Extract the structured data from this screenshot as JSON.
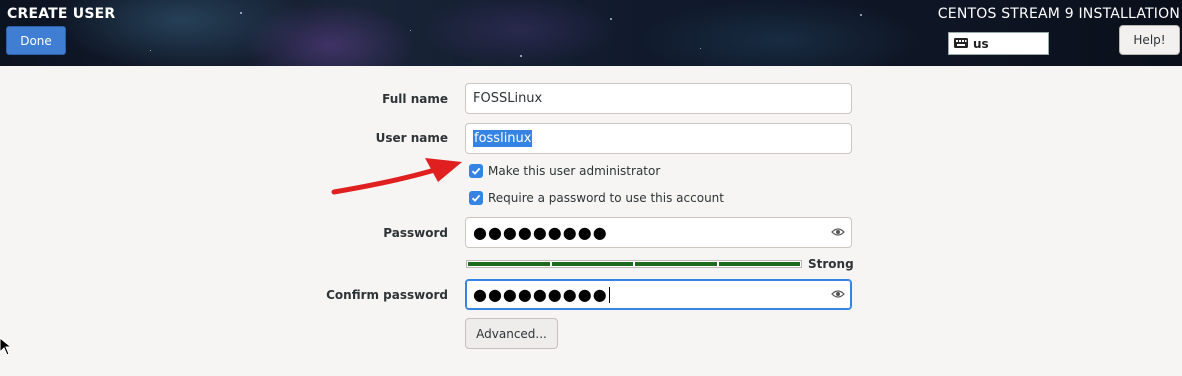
{
  "header": {
    "spoke_title": "CREATE USER",
    "done_label": "Done",
    "product_title": "CENTOS STREAM 9 INSTALLATION",
    "keyboard_layout": "us",
    "help_label": "Help!"
  },
  "form": {
    "full_name": {
      "label": "Full name",
      "value": "FOSSLinux"
    },
    "user_name": {
      "label": "User name",
      "value": "fosslinux"
    },
    "make_admin": {
      "label": "Make this user administrator",
      "checked": true
    },
    "require_password": {
      "label": "Require a password to use this account",
      "checked": true
    },
    "password": {
      "label": "Password",
      "value": "●●●●●●●●●"
    },
    "strength": {
      "label": "Strong",
      "level": 1.0
    },
    "confirm_password": {
      "label": "Confirm password",
      "value": "●●●●●●●●●"
    },
    "advanced_label": "Advanced..."
  },
  "colors": {
    "accent": "#3584e4",
    "done_button": "#3f7ed3",
    "strength_bar": "#1e6b1e",
    "annotation_arrow": "#e02020"
  },
  "icons": {
    "keyboard": "keyboard-icon",
    "reveal": "eye-icon",
    "check": "checkmark-icon",
    "pointer": "mouse-pointer-icon"
  }
}
